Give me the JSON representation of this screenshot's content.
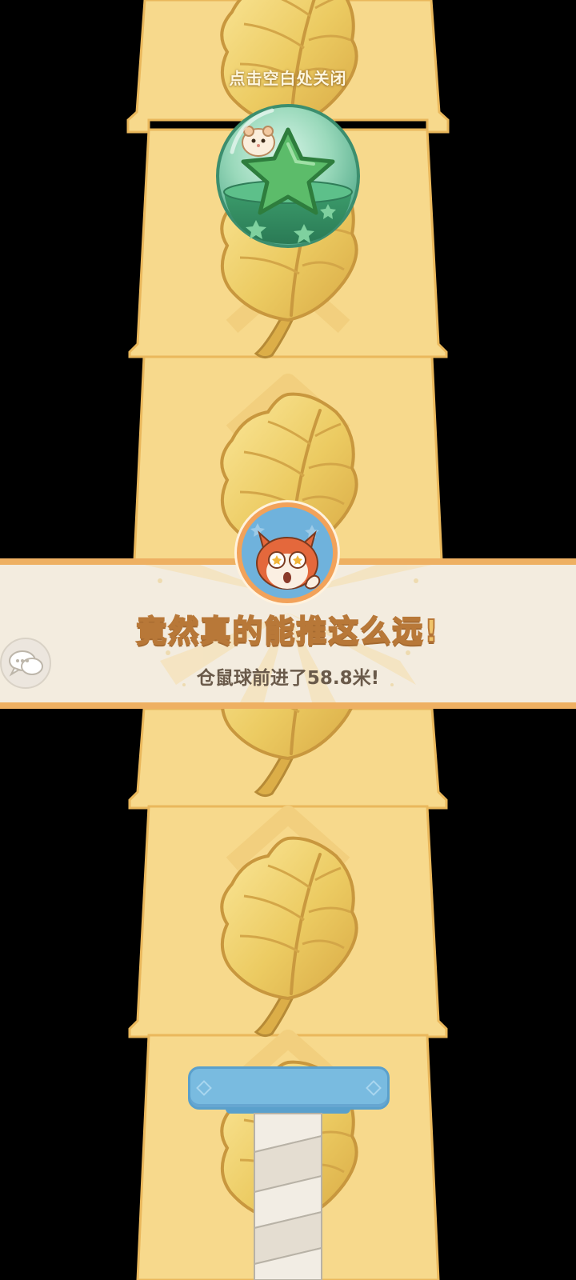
{
  "overlay": {
    "close_hint": "点击空白处关闭"
  },
  "result_banner": {
    "headline": "竟然真的能推这么远!",
    "detail": "仓鼠球前进了58.8米!"
  },
  "colors": {
    "path_fill": "#f7d98c",
    "path_edge": "#eab85c",
    "leaf_gold": "#e9c65a",
    "banner_bg": "#f3ecdf",
    "banner_border": "#eeb062",
    "orb_green": "#3fae72",
    "spring_blue": "#79bbe0"
  },
  "icons": {
    "chat": "chat-bubbles-icon",
    "reward": "hamster-star-orb-icon",
    "leaf": "golden-leaf-icon",
    "avatar": "fox-avatar-icon"
  }
}
